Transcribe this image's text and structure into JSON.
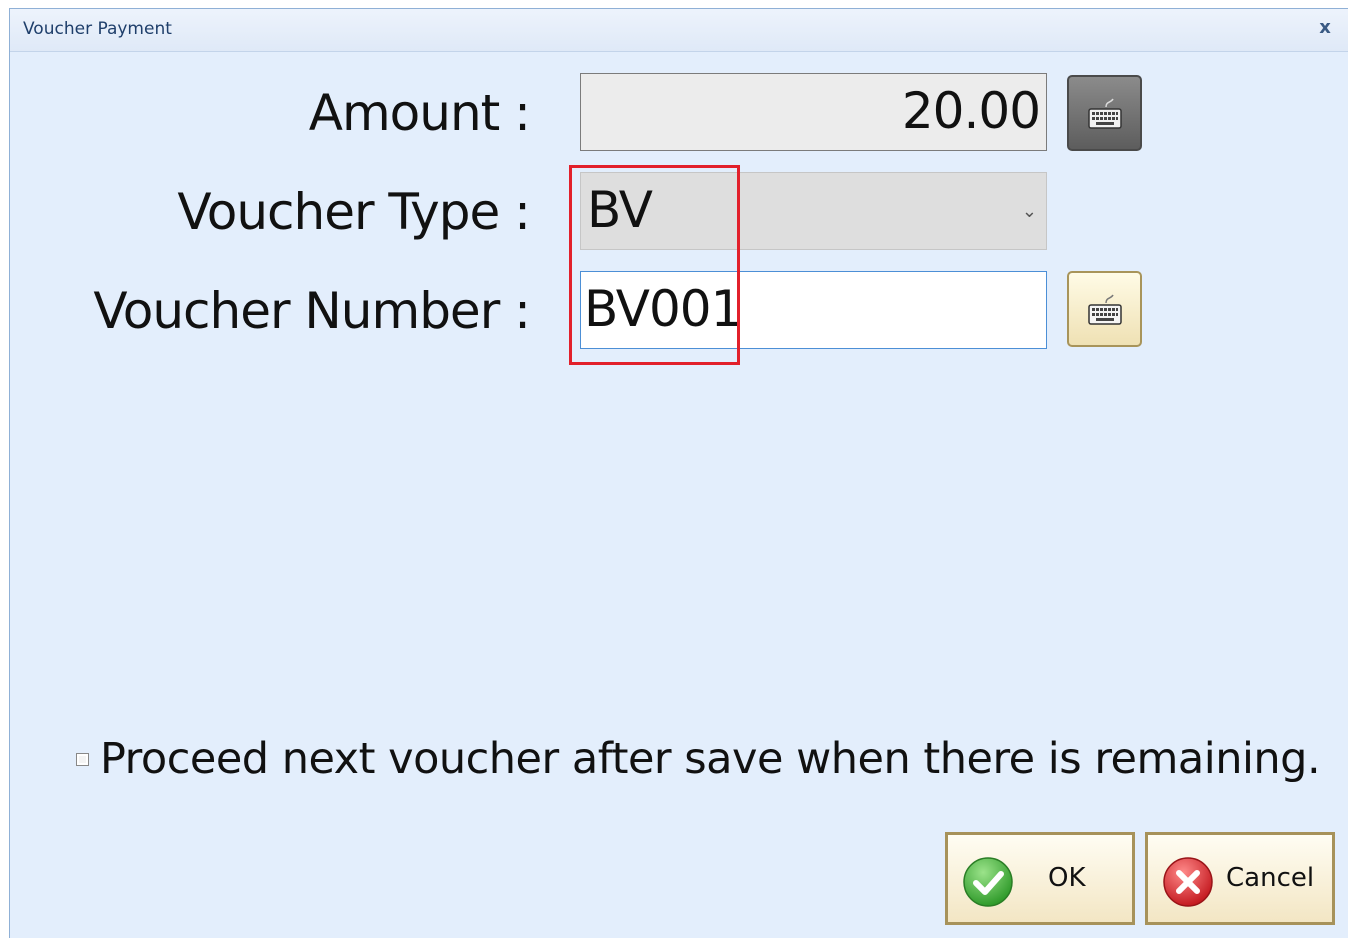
{
  "window": {
    "title": "Voucher Payment",
    "close_glyph": "x"
  },
  "form": {
    "amount_label": "Amount :",
    "amount_value": "20.00",
    "voucher_type_label": "Voucher Type :",
    "voucher_type_value": "BV",
    "voucher_number_label": "Voucher Number :",
    "voucher_number_value": "BV001"
  },
  "options": {
    "proceed_label": "Proceed next voucher after save when there is remaining.",
    "proceed_checked": false
  },
  "buttons": {
    "ok_label": "OK",
    "cancel_label": "Cancel"
  },
  "icons": {
    "keyboard": "keyboard-icon",
    "ok": "check-circle-icon",
    "cancel": "x-circle-icon",
    "dropdown": "chevron-down-icon"
  },
  "colors": {
    "window_bg": "#e3eefc",
    "highlight": "#e2202b",
    "ok_green": "#3fae3a",
    "cancel_red": "#d8242b"
  }
}
